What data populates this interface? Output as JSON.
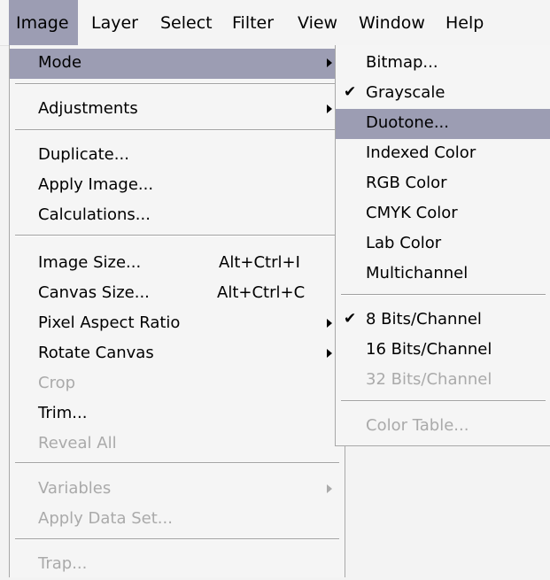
{
  "menubar": {
    "items": [
      {
        "label": "Image",
        "active": true
      },
      {
        "label": "Layer"
      },
      {
        "label": "Select"
      },
      {
        "label": "Filter"
      },
      {
        "label": "View"
      },
      {
        "label": "Window"
      },
      {
        "label": "Help"
      }
    ]
  },
  "image_menu": {
    "items": [
      {
        "label": "Mode",
        "submenu": true,
        "highlighted": true
      },
      {
        "label": "Adjustments",
        "submenu": true
      },
      {
        "label": "Duplicate..."
      },
      {
        "label": "Apply Image..."
      },
      {
        "label": "Calculations..."
      },
      {
        "label": "Image Size...",
        "shortcut": "Alt+Ctrl+I"
      },
      {
        "label": "Canvas Size...",
        "shortcut": "Alt+Ctrl+C"
      },
      {
        "label": "Pixel Aspect Ratio",
        "submenu": true
      },
      {
        "label": "Rotate Canvas",
        "submenu": true
      },
      {
        "label": "Crop",
        "disabled": true
      },
      {
        "label": "Trim..."
      },
      {
        "label": "Reveal All",
        "disabled": true
      },
      {
        "label": "Variables",
        "submenu": true,
        "disabled": true
      },
      {
        "label": "Apply Data Set...",
        "disabled": true
      },
      {
        "label": "Trap...",
        "disabled": true
      }
    ]
  },
  "mode_submenu": {
    "items": [
      {
        "label": "Bitmap..."
      },
      {
        "label": "Grayscale",
        "checked": true
      },
      {
        "label": "Duotone...",
        "highlighted": true
      },
      {
        "label": "Indexed Color"
      },
      {
        "label": "RGB Color"
      },
      {
        "label": "CMYK Color"
      },
      {
        "label": "Lab Color"
      },
      {
        "label": "Multichannel"
      },
      {
        "label": "8 Bits/Channel",
        "checked": true
      },
      {
        "label": "16 Bits/Channel"
      },
      {
        "label": "32 Bits/Channel",
        "disabled": true
      },
      {
        "label": "Color Table...",
        "disabled": true
      }
    ]
  },
  "colors": {
    "highlight": "#9c9db3",
    "disabled_text": "#aaaaaa",
    "menu_bg": "#f5f5f5"
  }
}
